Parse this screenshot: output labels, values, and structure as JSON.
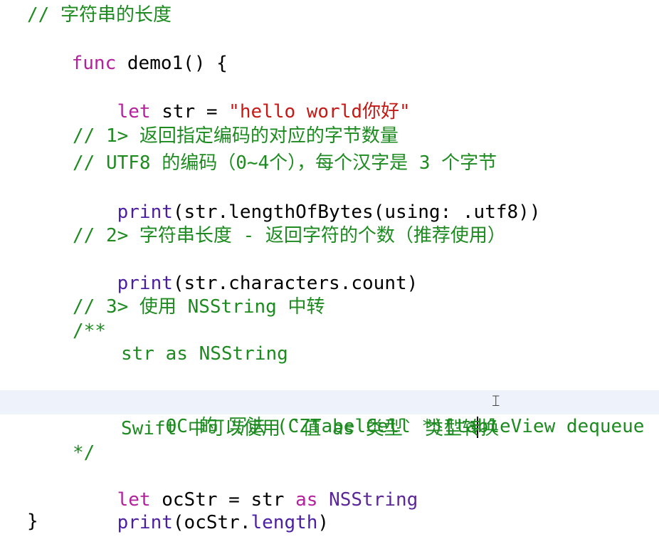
{
  "comment_length": "// 字符串的长度",
  "func_kw": "func",
  "func_name": " demo1() {",
  "let1_kw": "let",
  "let1_name": " str = ",
  "let1_value": "\"hello world你好\"",
  "comment_1": "// 1> 返回指定编码的对应的字节数量",
  "comment_utf8": "// UTF8 的编码（0~4个），每个汉字是 3 个字节",
  "line_bytes_fn": "print",
  "line_bytes_rest": "(str.lengthOfBytes(using: .utf8))",
  "comment_2": "// 2> 字符串长度 - 返回字符的个数（推荐使用）",
  "line_count_fn": "print",
  "line_count_rest": "(str.characters.count)",
  "comment_3": "// 3> 使用 NSString 中转",
  "doc_open": "/**",
  "doc_line1": "str as NSString",
  "doc_line2_before": "OC 的 写法 (CZTabelCell *)[ta",
  "doc_line2_after": "bleView dequeue",
  "doc_line3": "Swift 中可以使用 `值 as 类型` 类型转换",
  "doc_close": "*/",
  "let2_kw": "let",
  "let2_name": " ocStr = str ",
  "let2_as": "as",
  "let2_type": "NSString",
  "line_length_fn": "print",
  "line_length_open": "(ocStr.",
  "line_length_prop": "length",
  "line_length_close": ")",
  "closing_brace": "}",
  "colors": {
    "comment": "#1d8b20",
    "keyword": "#b4219c",
    "string": "#c41a16",
    "type": "#5c2699",
    "member": "#4b1fa3",
    "current_line": "#eef3fb"
  },
  "icons": {
    "cursor": "i-beam-cursor-icon"
  }
}
